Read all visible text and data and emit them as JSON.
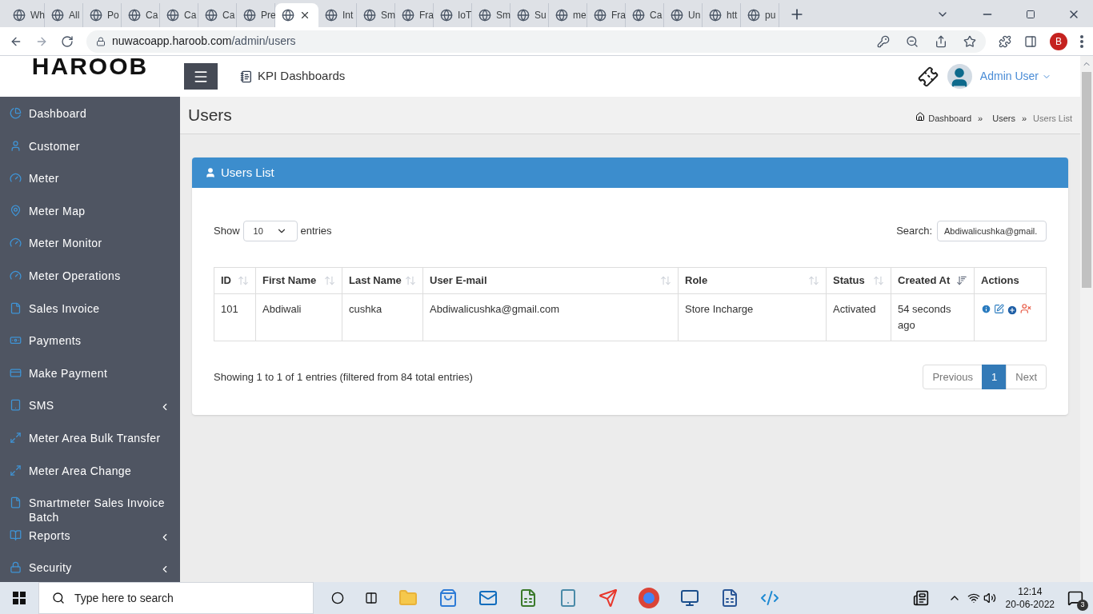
{
  "browser": {
    "tabs": [
      {
        "label": "Wh",
        "selected": false
      },
      {
        "label": "All",
        "selected": false
      },
      {
        "label": "Po",
        "selected": false
      },
      {
        "label": "Ca",
        "selected": false
      },
      {
        "label": "Ca",
        "selected": false
      },
      {
        "label": "Ca",
        "selected": false
      },
      {
        "label": "Pre",
        "selected": false
      },
      {
        "selected": true
      },
      {
        "label": "Int",
        "selected": false
      },
      {
        "label": "Sm",
        "selected": false
      },
      {
        "label": "Fra",
        "selected": false
      },
      {
        "label": "IoT",
        "selected": false
      },
      {
        "label": "Sm",
        "selected": false
      },
      {
        "label": "Su",
        "selected": false
      },
      {
        "label": "me",
        "selected": false
      },
      {
        "label": "Fra",
        "selected": false
      },
      {
        "label": "Ca",
        "selected": false
      },
      {
        "label": "Un",
        "selected": false
      },
      {
        "label": "htt",
        "selected": false
      },
      {
        "label": "pu",
        "selected": false
      }
    ],
    "url_host": "nuwacoapp.haroob.com",
    "url_path": "/admin/users",
    "profile": "B"
  },
  "header": {
    "logo": "HAROOB",
    "menu_item": "KPI Dashboards",
    "user": "Admin User"
  },
  "sidebar": {
    "items": [
      {
        "label": "Dashboard",
        "expandable": false
      },
      {
        "label": "Customer",
        "expandable": false
      },
      {
        "label": "Meter",
        "expandable": false
      },
      {
        "label": "Meter Map",
        "expandable": false
      },
      {
        "label": "Meter Monitor",
        "expandable": false
      },
      {
        "label": "Meter Operations",
        "expandable": false
      },
      {
        "label": "Sales Invoice",
        "expandable": false
      },
      {
        "label": "Payments",
        "expandable": false
      },
      {
        "label": "Make Payment",
        "expandable": false
      },
      {
        "label": "SMS",
        "expandable": true
      },
      {
        "label": "Meter Area Bulk Transfer",
        "expandable": false
      },
      {
        "label": "Meter Area Change",
        "expandable": false
      },
      {
        "label": "Smartmeter Sales Invoice Batch",
        "expandable": false
      },
      {
        "label": "Reports",
        "expandable": true
      },
      {
        "label": "Security",
        "expandable": true
      }
    ]
  },
  "page": {
    "title": "Users",
    "breadcrumb": [
      "Dashboard",
      "Users",
      "Users List"
    ],
    "separator": "»"
  },
  "card": {
    "title": "Users List",
    "show_label": "Show",
    "page_size": "10",
    "entries_label": "entries",
    "search_label": "Search:",
    "search_value": "Abdiwalicushka@gmail.",
    "table": {
      "columns": [
        {
          "label": "ID",
          "sortable": true,
          "sorted": false
        },
        {
          "label": "First Name",
          "sortable": true,
          "sorted": false
        },
        {
          "label": "Last Name",
          "sortable": true,
          "sorted": false
        },
        {
          "label": "User E-mail",
          "sortable": true,
          "sorted": false
        },
        {
          "label": "Role",
          "sortable": true,
          "sorted": false
        },
        {
          "label": "Status",
          "sortable": true,
          "sorted": false
        },
        {
          "label": "Created At",
          "sortable": true,
          "sorted": true
        },
        {
          "label": "Actions",
          "sortable": false
        }
      ],
      "rows": [
        [
          "101",
          "Abdiwali",
          "cushka",
          "Abdiwalicushka@gmail.com",
          "Store Incharge",
          "Activated",
          "54 seconds ago"
        ]
      ]
    },
    "info": "Showing 1 to 1 of 1 entries (filtered from 84 total entries)",
    "pagination": [
      {
        "label": "Previous",
        "selected": false
      },
      {
        "label": "1",
        "selected": true
      },
      {
        "label": "Next",
        "selected": false
      }
    ]
  },
  "taskbar": {
    "search_placeholder": "Type here to search",
    "time": "12:14",
    "date": "20-06-2022",
    "notifications": "3"
  }
}
